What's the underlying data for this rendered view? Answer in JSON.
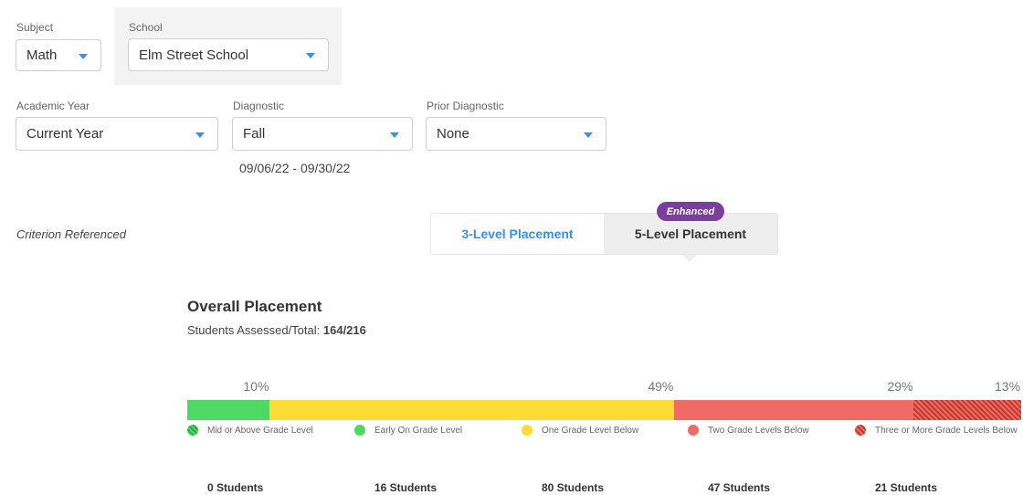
{
  "filters": {
    "subject": {
      "label": "Subject",
      "value": "Math"
    },
    "school": {
      "label": "School",
      "value": "Elm Street School"
    },
    "academic_year": {
      "label": "Academic Year",
      "value": "Current Year"
    },
    "diagnostic": {
      "label": "Diagnostic",
      "value": "Fall",
      "date_range": "09/06/22 - 09/30/22"
    },
    "prior_diagnostic": {
      "label": "Prior Diagnostic",
      "value": "None"
    }
  },
  "criterion_label": "Criterion Referenced",
  "placement_toggle": {
    "badge": "Enhanced",
    "options": [
      "3-Level Placement",
      "5-Level Placement"
    ],
    "selected": "5-Level Placement"
  },
  "overall": {
    "title": "Overall Placement",
    "assessed_label": "Students Assessed/Total: ",
    "assessed_value": "164/216"
  },
  "colors": {
    "accent_blue": "#3a8ef0",
    "mid_or_above": "#3aa64a",
    "early_on": "#4cd964",
    "one_below": "#fddc36",
    "two_below": "#f06b66",
    "three_or_more": "#c0392b",
    "badge_purple": "#7a3e9d"
  },
  "chart_data": {
    "type": "bar",
    "orientation": "horizontal-stacked",
    "categories": [
      "Mid or Above Grade Level",
      "Early On Grade Level",
      "One Grade Level Below",
      "Two Grade Levels Below",
      "Three or More Grade Levels Below"
    ],
    "percent_labels": [
      "",
      "10%",
      "49%",
      "29%",
      "13%"
    ],
    "values": [
      0,
      10,
      49,
      29,
      13
    ],
    "students": [
      "0 Students",
      "16 Students",
      "80 Students",
      "47 Students",
      "21 Students"
    ],
    "student_counts": [
      0,
      16,
      80,
      47,
      21
    ]
  }
}
